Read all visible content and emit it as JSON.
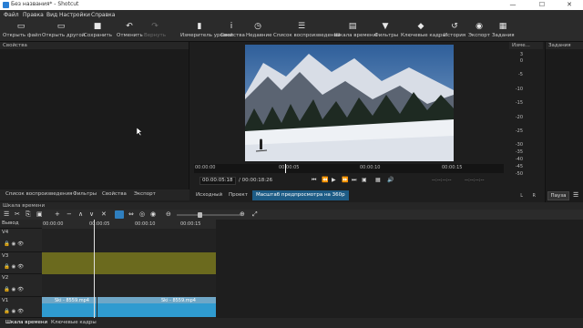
{
  "window": {
    "title": "Без названия* - Shotcut",
    "min": "—",
    "max": "☐",
    "close": "✕"
  },
  "menu": [
    "Файл",
    "Правка",
    "Вид",
    "Настройки",
    "Справка"
  ],
  "toolbar": [
    {
      "label": "Открыть файл",
      "icon": "folder-icon",
      "glyph": "▭",
      "dim": false
    },
    {
      "label": "Открыть другой",
      "icon": "folder-open-icon",
      "glyph": "▭",
      "dim": false
    },
    {
      "label": "Сохранить",
      "icon": "save-icon",
      "glyph": "■",
      "dim": false
    },
    {
      "label": "Отменить",
      "icon": "undo-icon",
      "glyph": "↶",
      "dim": false
    },
    {
      "label": "Вернуть",
      "icon": "redo-icon",
      "glyph": "↷",
      "dim": true
    },
    {
      "label": "Измеритель уровня",
      "icon": "meter-icon",
      "glyph": "▮",
      "dim": false
    },
    {
      "label": "Свойства",
      "icon": "info-icon",
      "glyph": "i",
      "dim": false
    },
    {
      "label": "Недавние",
      "icon": "clock-icon",
      "glyph": "◷",
      "dim": false
    },
    {
      "label": "Список воспроизведения",
      "icon": "playlist-icon",
      "glyph": "☰",
      "dim": false
    },
    {
      "label": "Шкала времени",
      "icon": "timeline-icon",
      "glyph": "▤",
      "dim": false
    },
    {
      "label": "Фильтры",
      "icon": "filter-icon",
      "glyph": "▼",
      "dim": false
    },
    {
      "label": "Ключевые кадры",
      "icon": "keyframes-icon",
      "glyph": "◆",
      "dim": false
    },
    {
      "label": "История",
      "icon": "history-icon",
      "glyph": "↺",
      "dim": false
    },
    {
      "label": "Экспорт",
      "icon": "export-icon",
      "glyph": "◉",
      "dim": false
    },
    {
      "label": "Задания",
      "icon": "jobs-icon",
      "glyph": "▦",
      "dim": false
    }
  ],
  "panels": {
    "properties": "Свойства",
    "vu": "Изме...",
    "jobs": "Задания"
  },
  "left_tabs": [
    "Список воспроизведения",
    "Фильтры",
    "Свойства",
    "Экспорт"
  ],
  "player": {
    "ruler": [
      "00:00:00",
      "00:00:05",
      "00:00:10",
      "00:00:15"
    ],
    "position": "00:00:05:18",
    "duration": "/ 00:00:18:26",
    "in_point": "--:--:--:--",
    "out_point": "--:--:--:--",
    "tabs": [
      "Исходный",
      "Проект",
      "Масштаб предпросмотра на 360p"
    ]
  },
  "vu_scale": [
    "3",
    "0",
    "-5",
    "-10",
    "-15",
    "-20",
    "-25",
    "-30",
    "-35",
    "-40",
    "-45",
    "-50"
  ],
  "vu_lr": [
    "L",
    "R"
  ],
  "jobs": {
    "pause": "Пауза"
  },
  "timeline": {
    "title": "Шкала времени",
    "output_label": "Вывод",
    "ruler": [
      "00:00:00",
      "00:00:05",
      "00:00:10",
      "00:00:15"
    ],
    "tracks": [
      {
        "name": "V4",
        "ics": "🔒 ◉ 👁"
      },
      {
        "name": "V3",
        "ics": "🔒 ◉ 👁"
      },
      {
        "name": "V2",
        "ics": "🔒 ◉ 👁"
      },
      {
        "name": "V1",
        "ics": "🔒 ◉ 👁"
      }
    ],
    "clips": [
      {
        "label": "Ski - 8559.mp4"
      },
      {
        "label": "Ski - 8559.mp4"
      }
    ]
  },
  "bottom_tabs": [
    "Шкала времени",
    "Ключевые кадры"
  ],
  "colors": {
    "accent": "#1d5c86",
    "clip": "#2f9bd0",
    "v3": "#6b6a1e"
  }
}
